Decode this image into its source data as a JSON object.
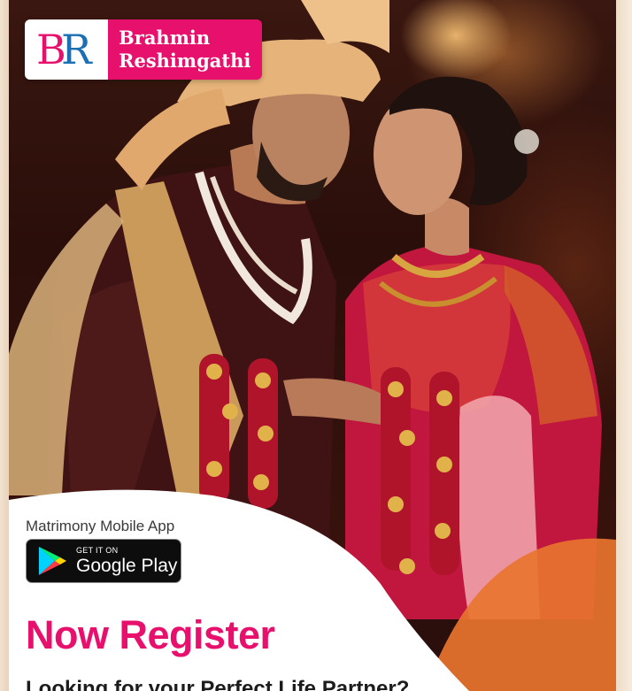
{
  "brand": {
    "monogram_b": "B",
    "monogram_r": "R",
    "name_line1": "Brahmin",
    "name_line2": "Reshimgathi"
  },
  "promo": {
    "subtitle": "Matrimony Mobile App",
    "store_badge_small": "GET IT ON",
    "store_badge_big": "Google Play",
    "headline": "Now Register",
    "tagline": "Looking for your Perfect Life Partner?"
  },
  "colors": {
    "brand_pink": "#e8106d",
    "brand_blue": "#1a6fb5",
    "wave_orange": "#e8742f",
    "text_dark": "#1c1c1c"
  },
  "icons": {
    "store_icon": "google-play-icon"
  }
}
